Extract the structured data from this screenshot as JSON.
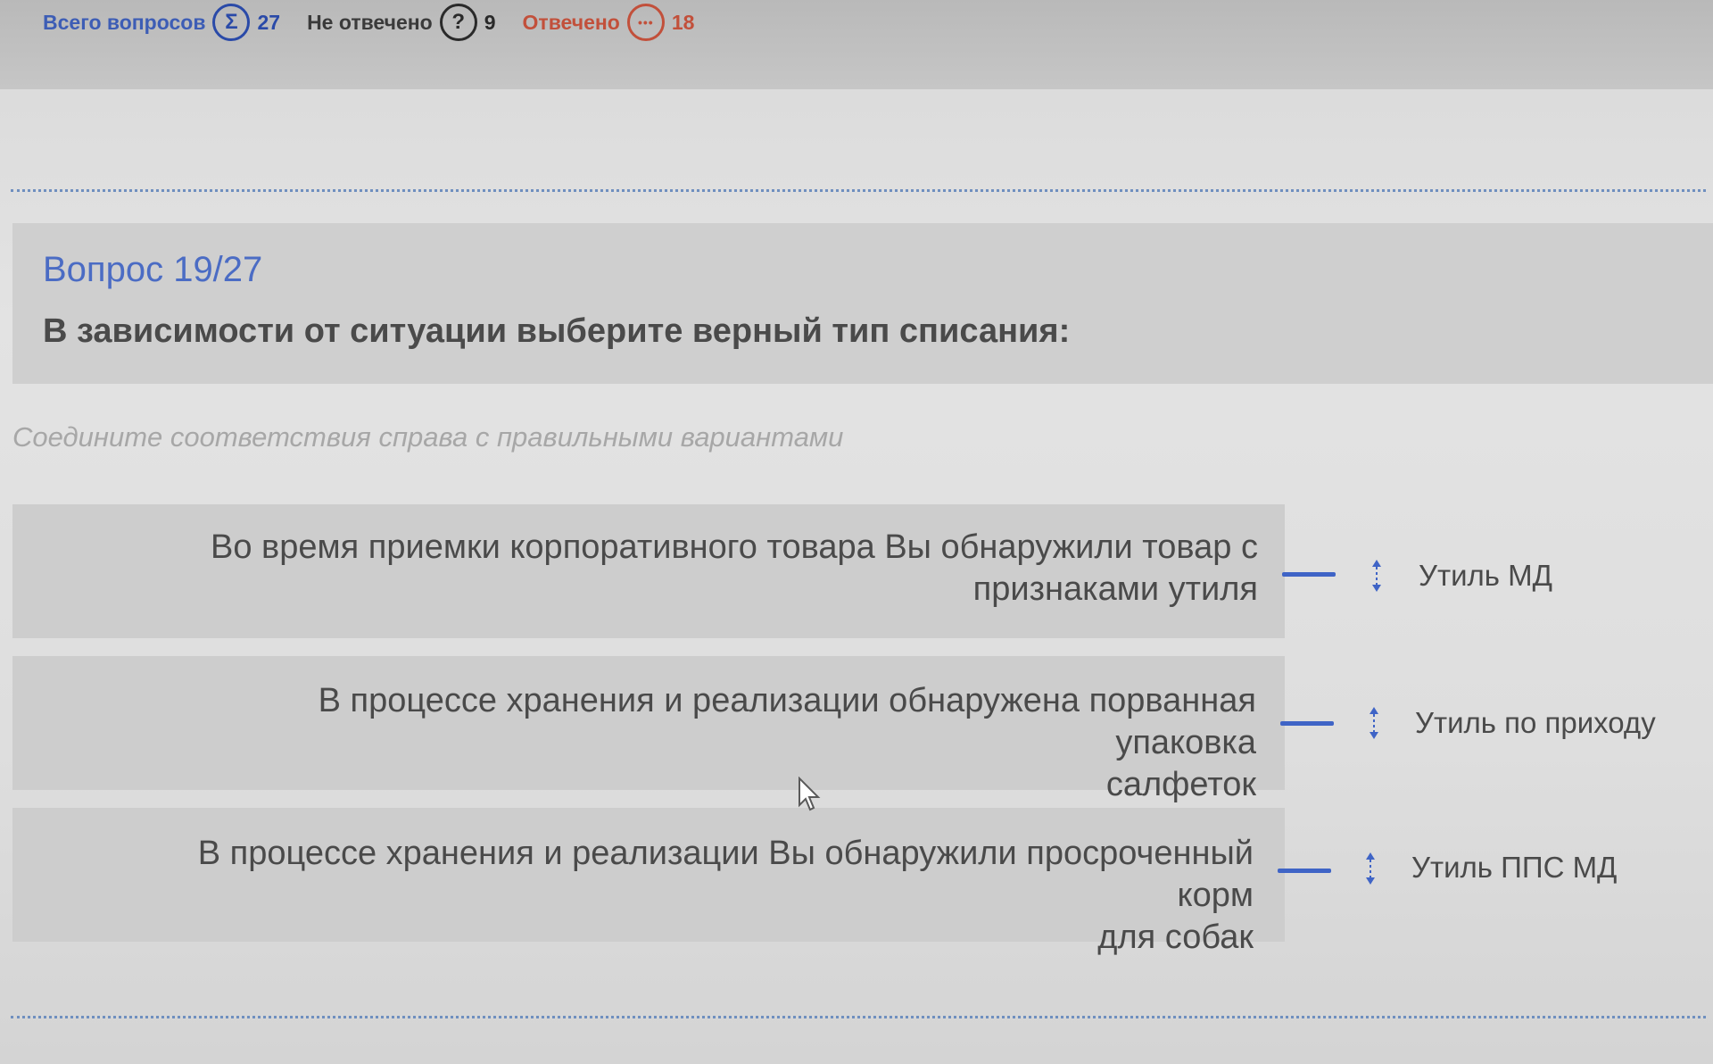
{
  "stats": {
    "total_label": "Всего вопросов",
    "total_icon": "sigma-icon",
    "total_glyph": "Σ",
    "total_value": "27",
    "unanswered_label": "Не отвечено",
    "unanswered_icon": "question-mark-icon",
    "unanswered_glyph": "?",
    "unanswered_value": "9",
    "answered_label": "Отвечено",
    "answered_icon": "dots-icon",
    "answered_glyph": "•••",
    "answered_value": "18"
  },
  "question": {
    "number": "Вопрос 19/27",
    "text": "В зависимости от ситуации выберите верный тип списания:",
    "instruction": "Соедините соответствия справа с правильными вариантами"
  },
  "pairs": [
    {
      "premise_line1": "Во время приемки корпоративного товара Вы обнаружили товар с",
      "premise_line2": "признаками утиля",
      "answer": "Утиль МД"
    },
    {
      "premise_line1": "В процессе хранения и реализации обнаружена порванная упаковка",
      "premise_line2": "салфеток",
      "answer": "Утиль по приходу"
    },
    {
      "premise_line1": "В процессе хранения и реализации Вы обнаружили просроченный корм",
      "premise_line2": "для собак",
      "answer": "Утиль ППС МД"
    }
  ],
  "colors": {
    "accent": "#3f64c6",
    "answered": "#c2503b",
    "text": "#4a4a4a",
    "instruction": "#a7a7a7"
  }
}
